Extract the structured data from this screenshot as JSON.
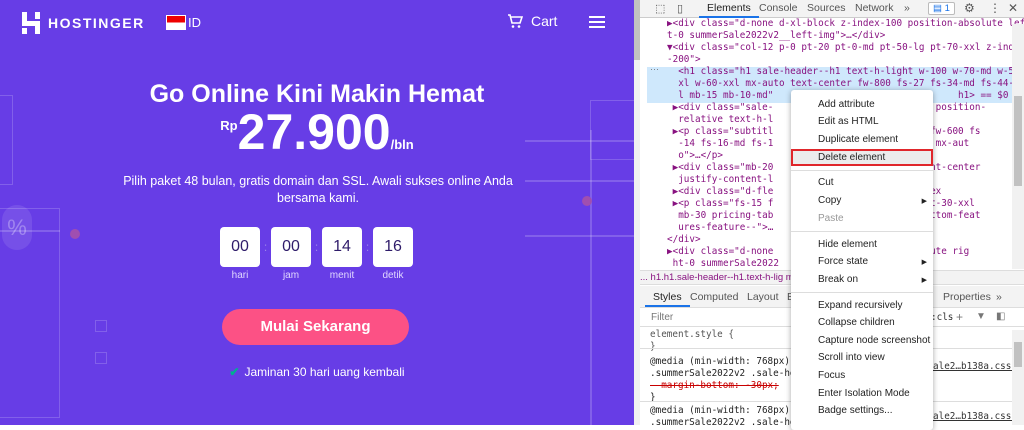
{
  "site": {
    "logo": "HOSTINGER",
    "lang": "ID",
    "cart": "Cart",
    "title": "Go Online Kini Makin Hemat",
    "price": {
      "currency": "Rp",
      "amount": "27.900",
      "period": "/bln"
    },
    "subtitle": "Pilih paket 48 bulan, gratis domain dan SSL. Awali sukses online Anda bersama kami.",
    "countdown": [
      {
        "value": "00",
        "label": "hari"
      },
      {
        "value": "00",
        "label": "jam"
      },
      {
        "value": "14",
        "label": "menit"
      },
      {
        "value": "16",
        "label": "detik"
      }
    ],
    "cta": "Mulai Sekarang",
    "guarantee": "Jaminan 30 hari uang kembali",
    "colors": {
      "bg": "#673de6",
      "cta": "#fc5185"
    }
  },
  "devtools": {
    "tabs": [
      "Elements",
      "Console",
      "Sources",
      "Network",
      "»"
    ],
    "issues": "1",
    "tree": [
      "▶<div class=\"d-none d-xl-block z-index-100 position-absolute lef",
      "t-0 summerSale2022v2__left-img\">…</div>",
      "▼<div class=\"col-12 p-0 pt-20 pt-0-md pt-50-lg pt-70-xxl z-index",
      "-200\">",
      "  <h1 class=\"h1 sale-header--h1 text-h-light w-100 w-70-md w-50-",
      "  xl w-60-xxl mx-auto text-center fw-800 fs-27 fs-34-md fs-44-xx",
      "  l mb-15 mb-10-md\"                                 h1> == $0",
      " ▶<div class=\"sale-                      t-bold position-",
      "  relative text-h-l",
      " ▶<p class=\"subtitl                     -light fw-600 fs",
      "  -14 fs-16-md fs-1                     -40-xxl mx-aut",
      "  o\">…</p>",
      " ▶<div class=\"mb-20                     y-content-center",
      "  justify-content-l",
      " ▶<div class=\"d-fle                     div> flex",
      " ▶<p class=\"fs-15 f                     mt-25 mt-30-xxl",
      "  mb-30 pricing-tab                     able-bottom-feat",
      "  ures-feature--\">…",
      "</div>",
      "▶<div class=\"d-none                    on-absolute rig",
      " ht-0 summerSale2022"
    ],
    "breadcrumb": "...  h1.h1.sale-header--h1.text-h-lig                    mx-auto.text-cente  ...",
    "style_tabs": [
      "Styles",
      "Computed",
      "Layout",
      "E",
      "Properties",
      "»"
    ],
    "filter": "Filter",
    "hov": ":cls",
    "styles": [
      "element.style {",
      "}",
      "@media (min-width: 768px)",
      ".summerSale2022v2 .sale-heade",
      "  margin-bottom: -30px;",
      "}",
      "@media (min-width: 768px)",
      ".summerSale2022v2 .sale-heade"
    ],
    "source": "ale2…b138a.css:1",
    "context_menu": [
      "Add attribute",
      "Edit as HTML",
      "Duplicate element",
      "Delete element",
      "Cut",
      "Copy",
      "Paste",
      "Hide element",
      "Force state",
      "Break on",
      "Expand recursively",
      "Collapse children",
      "Capture node screenshot",
      "Scroll into view",
      "Focus",
      "Enter Isolation Mode",
      "Badge settings..."
    ]
  }
}
